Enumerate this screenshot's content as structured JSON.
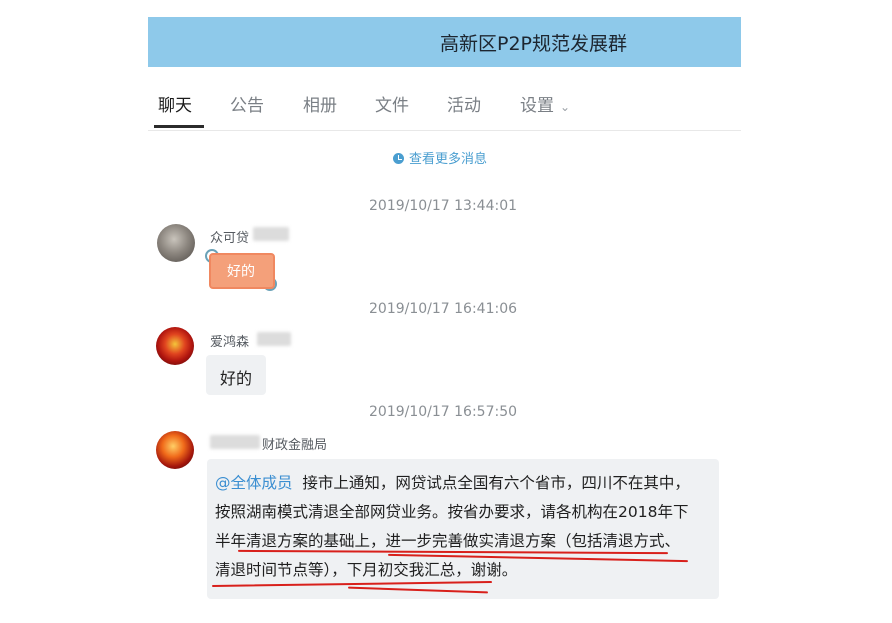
{
  "window": {
    "title": "高新区P2P规范发展群"
  },
  "tabs": [
    {
      "label": "聊天"
    },
    {
      "label": "公告"
    },
    {
      "label": "相册"
    },
    {
      "label": "文件"
    },
    {
      "label": "活动"
    },
    {
      "label": "设置"
    }
  ],
  "history": {
    "more_label": "查看更多消息"
  },
  "messages": [
    {
      "time": "2019/10/17 13:44:01",
      "sender": "众可贷",
      "sticker_text": "好的"
    },
    {
      "time": "2019/10/17 16:41:06",
      "sender": "爱鸿森",
      "text": "好的"
    },
    {
      "time": "2019/10/17 16:57:50",
      "sender": "财政金融局",
      "mention": "@全体成员",
      "lines": [
        "接市上通知，网贷试点全国有六个省市，四川不在其中，",
        "按照湖南模式清退全部网贷业务。按省办要求，请各机构在2018年下",
        "半年清退方案的基础上，进一步完善做实清退方案（包括清退方式、",
        "清退时间节点等），下月初交我汇总，谢谢。"
      ]
    }
  ],
  "colors": {
    "title_bar": "#8ec9ea",
    "link": "#4a9ed0",
    "annotation": "#d8201b"
  },
  "icons": [
    "clock-icon",
    "chevron-down-icon"
  ]
}
